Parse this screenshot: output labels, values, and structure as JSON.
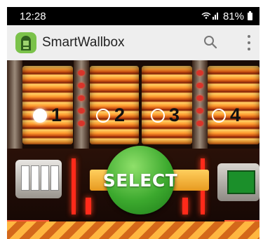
{
  "status_bar": {
    "time": "12:28",
    "battery": "81%"
  },
  "app_bar": {
    "title": "SmartWallbox",
    "icon": "jukebox-icon",
    "actions": [
      "search-icon",
      "overflow-menu-icon"
    ]
  },
  "selector": {
    "options": [
      {
        "label": "1",
        "selected": true
      },
      {
        "label": "2",
        "selected": false
      },
      {
        "label": "3",
        "selected": false
      },
      {
        "label": "4",
        "selected": false
      }
    ],
    "select_label": "SELECT"
  },
  "colors": {
    "select_button": "#3ca92e",
    "app_icon": "#7bc24a",
    "app_bar": "#eeeeee"
  }
}
